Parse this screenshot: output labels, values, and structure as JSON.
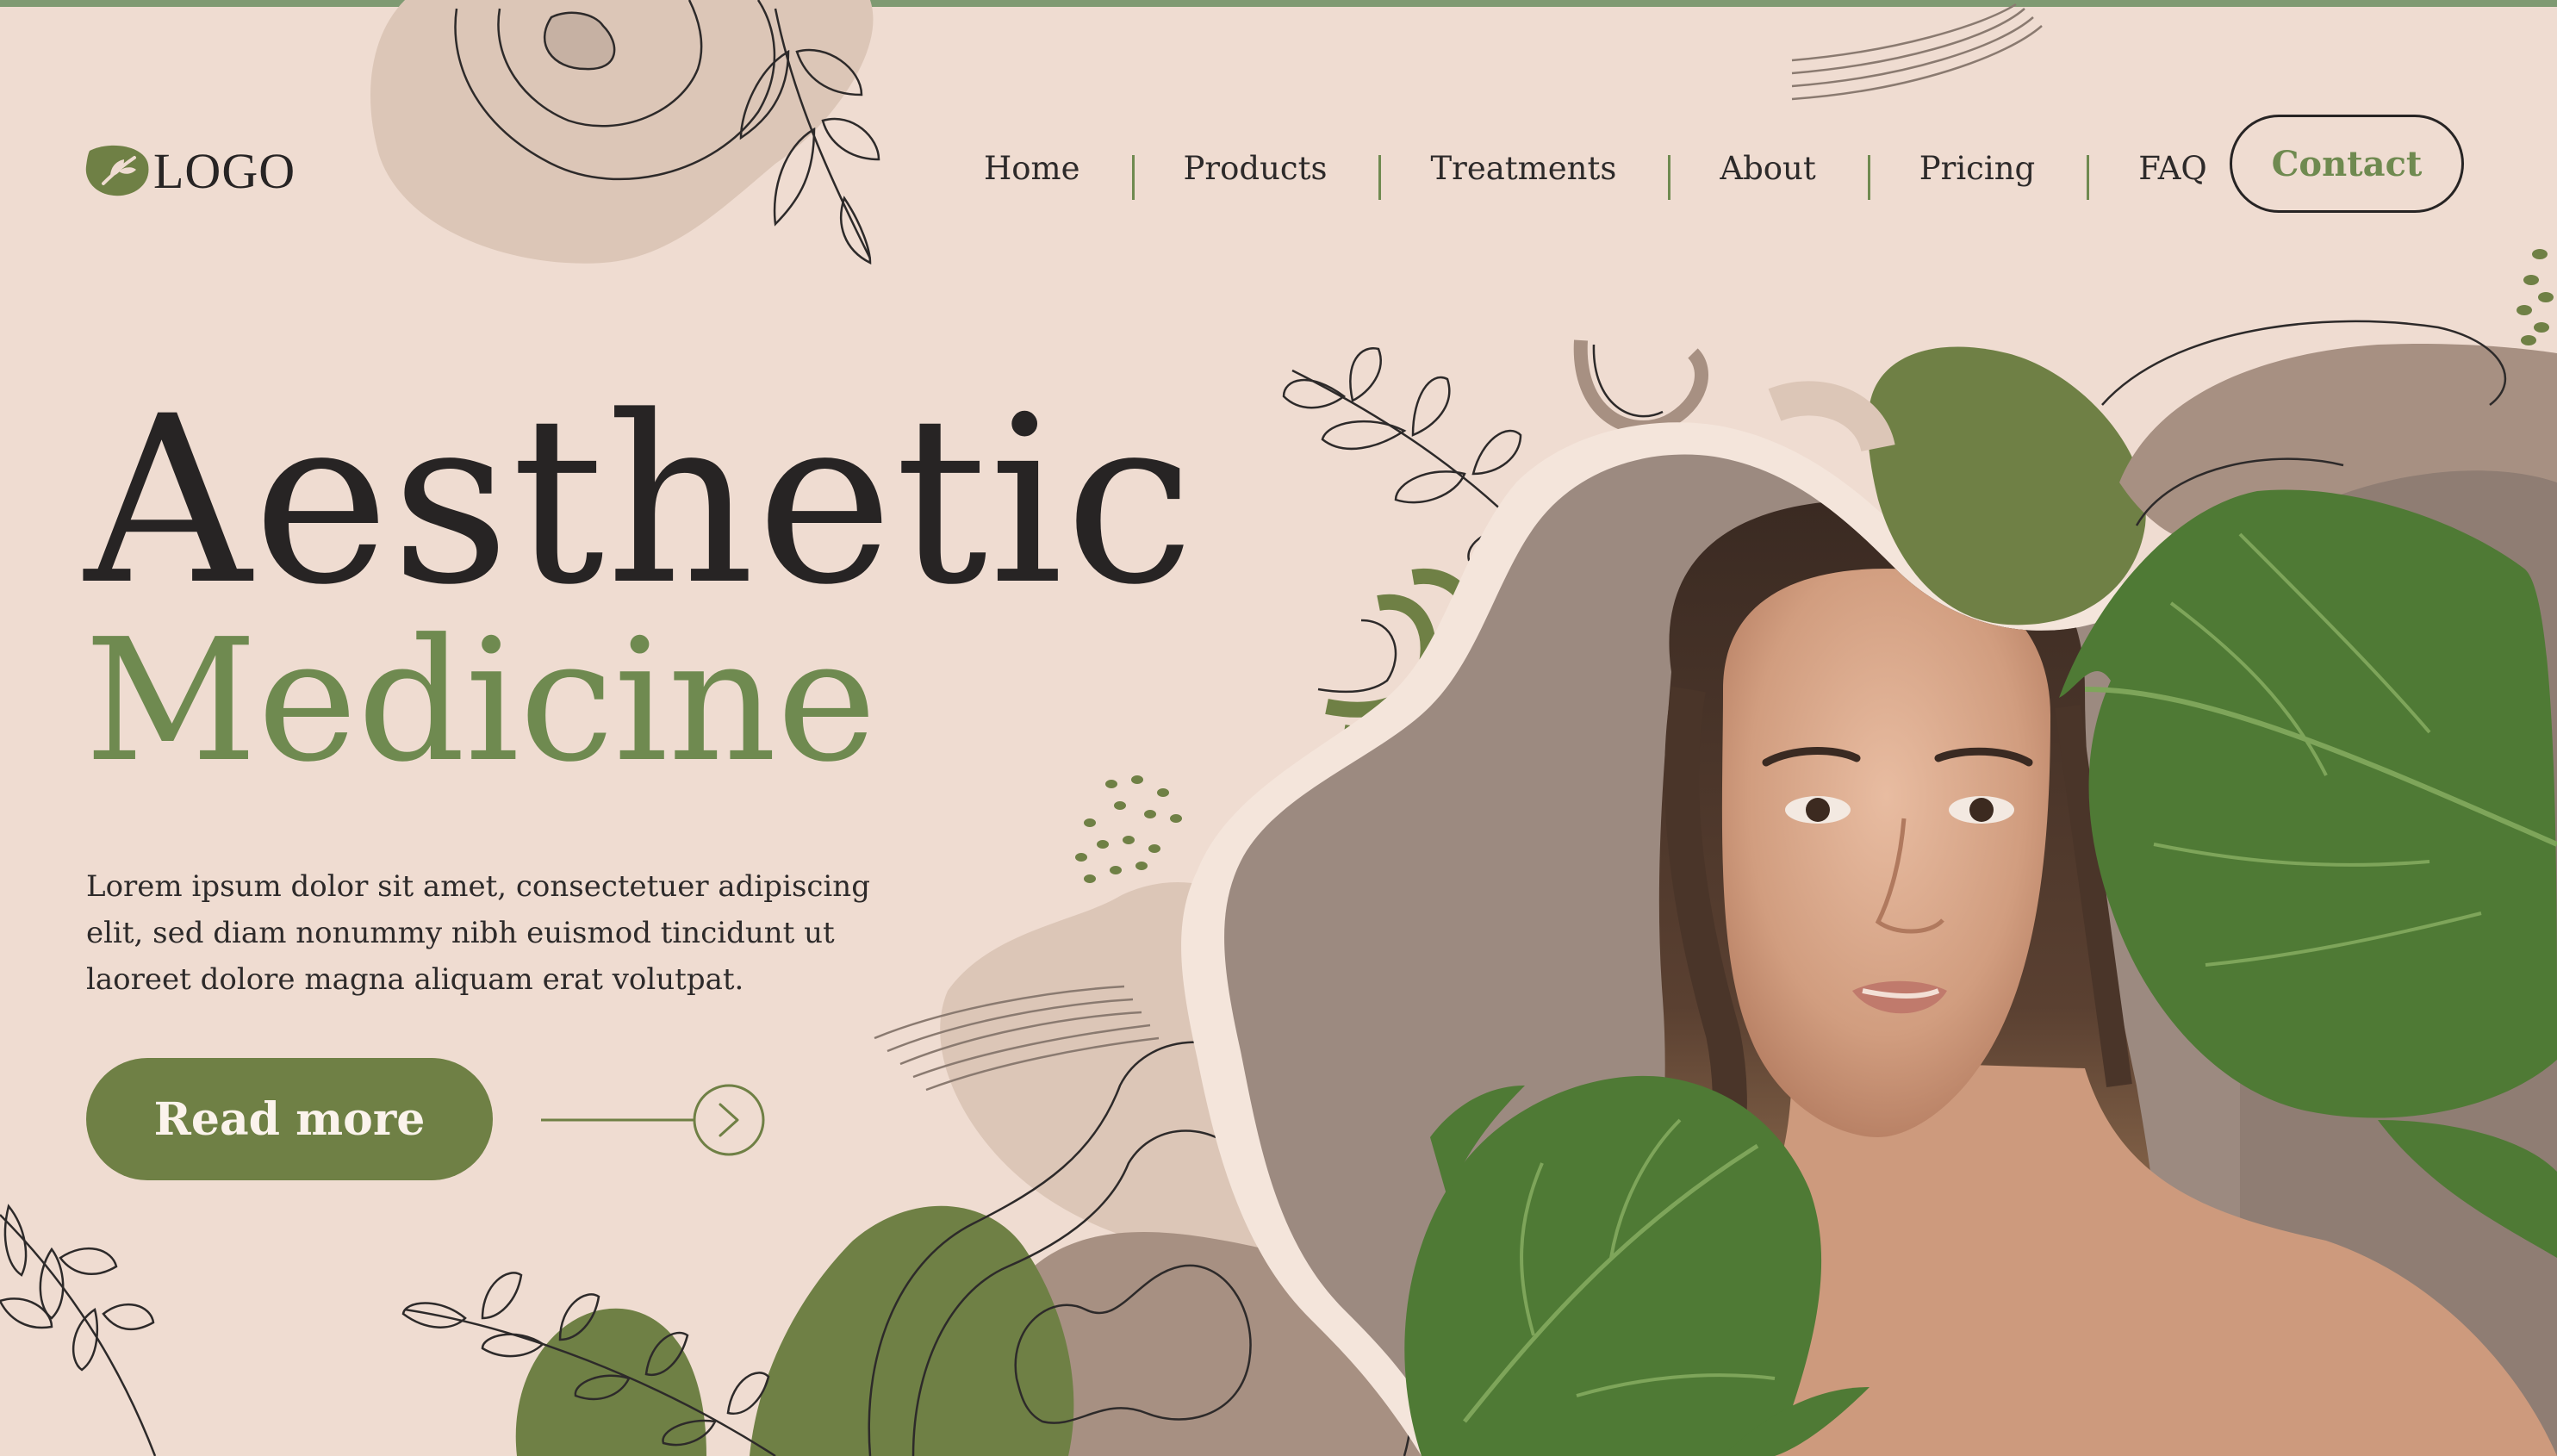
{
  "logo": {
    "text": "LOGO",
    "icon": "leaf-icon"
  },
  "nav": {
    "items": [
      "Home",
      "Products",
      "Treatments",
      "About",
      "Pricing",
      "FAQ"
    ],
    "contact_label": "Contact"
  },
  "hero": {
    "title_line1": "Aesthetic",
    "title_line2": "Medicine",
    "description": "Lorem ipsum dolor sit amet, consectetuer adipiscing elit, sed diam nonummy nibh euismod tincidunt ut laoreet dolore magna aliquam erat volutpat.",
    "read_more_label": "Read more",
    "arrow_icon": "arrow-right-circle-icon"
  },
  "colors": {
    "background": "#efdcd1",
    "accent_green": "#6f8045",
    "text_dark": "#272424",
    "taupe": "#a79082",
    "beige": "#dcc6b7"
  },
  "image": {
    "subject": "woman-portrait-with-monstera-leaves"
  }
}
